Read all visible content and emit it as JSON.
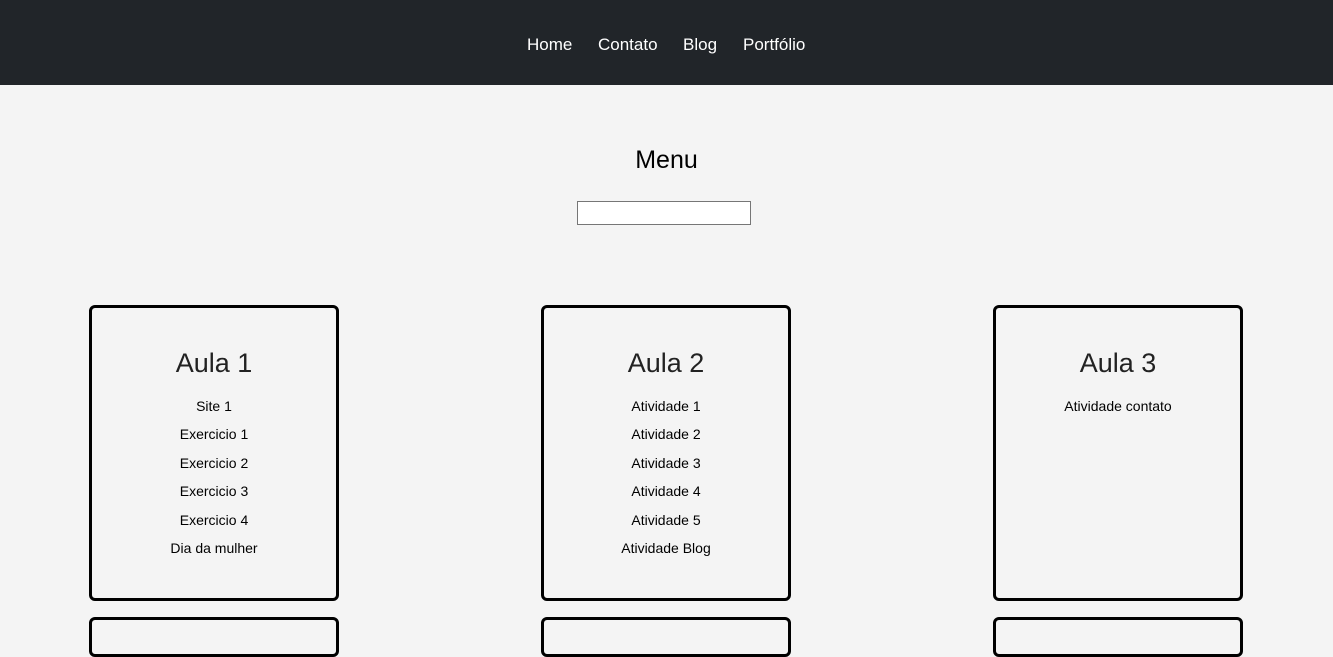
{
  "nav": {
    "items": [
      {
        "label": "Home"
      },
      {
        "label": "Contato"
      },
      {
        "label": "Blog"
      },
      {
        "label": "Portfólio"
      }
    ]
  },
  "main": {
    "title": "Menu",
    "search": {
      "value": "",
      "placeholder": ""
    }
  },
  "cards": [
    {
      "title": "Aula 1",
      "links": [
        "Site 1",
        "Exercicio 1",
        "Exercicio 2",
        "Exercicio 3",
        "Exercicio 4",
        "Dia da mulher"
      ]
    },
    {
      "title": "Aula 2",
      "links": [
        "Atividade 1",
        "Atividade 2",
        "Atividade 3",
        "Atividade 4",
        "Atividade 5",
        "Atividade Blog"
      ]
    },
    {
      "title": "Aula 3",
      "links": [
        "Atividade contato"
      ]
    }
  ]
}
